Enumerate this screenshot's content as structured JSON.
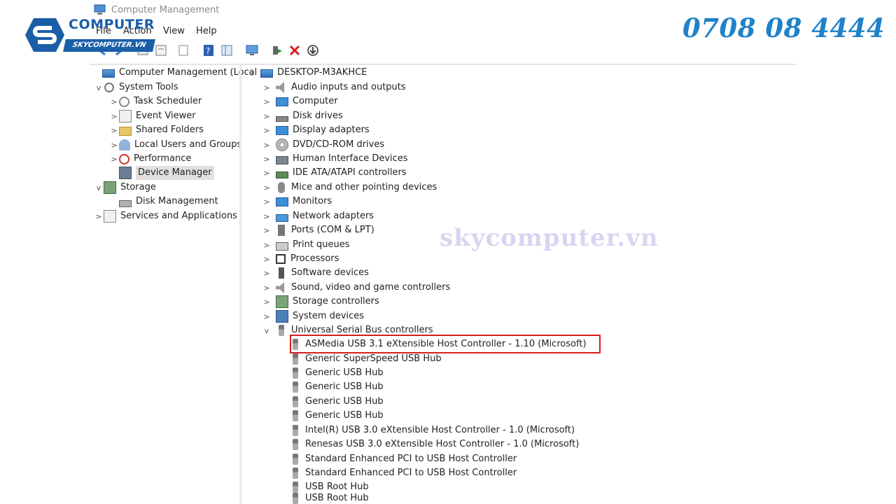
{
  "window": {
    "title": "Computer Management"
  },
  "menu": [
    "File",
    "Action",
    "View",
    "Help"
  ],
  "toolbar": {
    "icons": [
      "back-icon",
      "forward-icon",
      "up-icon",
      "properties-icon",
      "export-icon",
      "help-icon",
      "view-icon",
      "monitor-icon",
      "enable-device-icon",
      "uninstall-icon",
      "update-driver-icon"
    ]
  },
  "left_tree": [
    {
      "label": "Computer Management (Local",
      "icon": "computer-management-icon",
      "chev": ""
    },
    {
      "label": "System Tools",
      "icon": "tools-icon",
      "chev": "v"
    },
    {
      "label": "Task Scheduler",
      "icon": "clock-icon",
      "chev": ">"
    },
    {
      "label": "Event Viewer",
      "icon": "event-viewer-icon",
      "chev": ">"
    },
    {
      "label": "Shared Folders",
      "icon": "folder-icon",
      "chev": ">"
    },
    {
      "label": "Local Users and Groups",
      "icon": "users-icon",
      "chev": ">"
    },
    {
      "label": "Performance",
      "icon": "performance-icon",
      "chev": ">"
    },
    {
      "label": "Device Manager",
      "icon": "device-manager-icon",
      "chev": ""
    },
    {
      "label": "Storage",
      "icon": "storage-icon",
      "chev": "v"
    },
    {
      "label": "Disk Management",
      "icon": "disk-icon",
      "chev": ""
    },
    {
      "label": "Services and Applications",
      "icon": "services-icon",
      "chev": ">"
    }
  ],
  "right_tree": {
    "root": "DESKTOP-M3AKHCE",
    "categories": [
      "Audio inputs and outputs",
      "Computer",
      "Disk drives",
      "Display adapters",
      "DVD/CD-ROM drives",
      "Human Interface Devices",
      "IDE ATA/ATAPI controllers",
      "Mice and other pointing devices",
      "Monitors",
      "Network adapters",
      "Ports (COM & LPT)",
      "Print queues",
      "Processors",
      "Software devices",
      "Sound, video and game controllers",
      "Storage controllers",
      "System devices",
      "Universal Serial Bus controllers"
    ],
    "usb_devices": [
      "ASMedia USB 3.1 eXtensible Host Controller - 1.10 (Microsoft)",
      "Generic SuperSpeed USB Hub",
      "Generic USB Hub",
      "Generic USB Hub",
      "Generic USB Hub",
      "Generic USB Hub",
      "Intel(R) USB 3.0 eXtensible Host Controller - 1.0 (Microsoft)",
      "Renesas USB 3.0 eXtensible Host Controller - 1.0 (Microsoft)",
      "Standard Enhanced PCI to USB Host Controller",
      "Standard Enhanced PCI to USB Host Controller",
      "USB Root Hub",
      "USB Root Hub"
    ]
  },
  "branding": {
    "logo_word": "COMPUTER",
    "logo_sub": "SKYCOMPUTER.VN",
    "phone": "0708 08 4444",
    "watermark": "skycomputer.vn",
    "colors": {
      "brand_blue": "#1a5ea8",
      "phone_blue": "#1f82c9",
      "highlight_red": "#d21f1f"
    }
  }
}
